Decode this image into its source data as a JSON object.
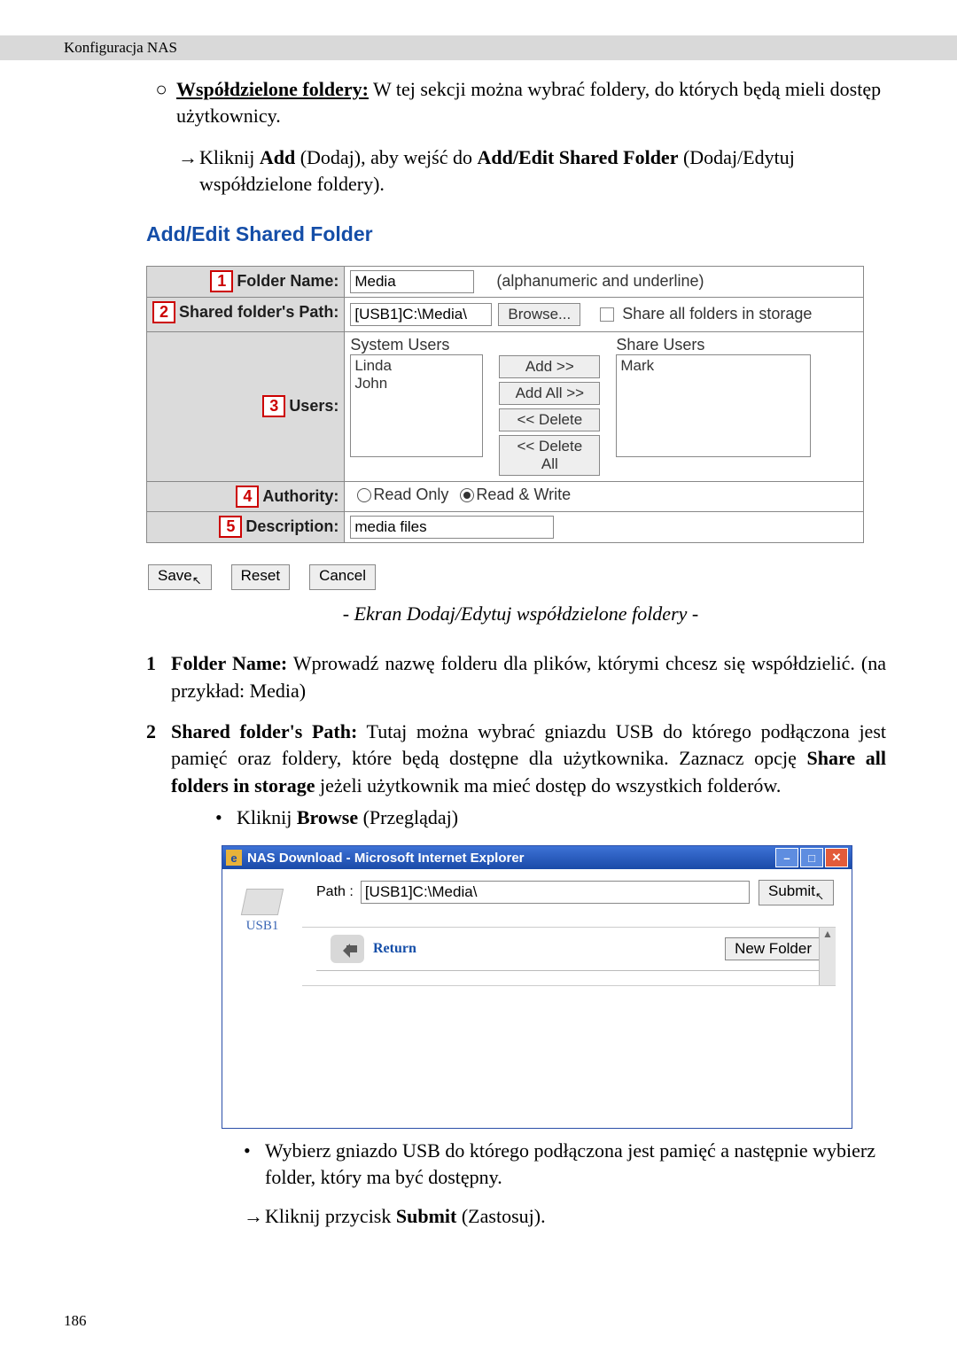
{
  "header": {
    "breadcrumb": "Konfiguracja NAS"
  },
  "intro": {
    "bullet1_prefix": "Współdzielone foldery:",
    "bullet1_rest": " W tej sekcji można wybrać foldery, do których będą mieli dostęp użytkownicy.",
    "arrow_line_1": "Kliknij ",
    "arrow_b1": "Add",
    "arrow_mid1": " (Dodaj), aby wejść do ",
    "arrow_b2": "Add/Edit Shared Folder",
    "arrow_mid2": " (Dodaj/Edytuj współdzielone foldery)."
  },
  "ui1": {
    "title": "Add/Edit Shared Folder",
    "rows": {
      "r1": {
        "num": "1",
        "label": "Folder Name:",
        "value": "Media",
        "hint": "(alphanumeric and underline)"
      },
      "r2": {
        "num": "2",
        "label": "Shared folder's Path:",
        "value": "[USB1]C:\\Media\\",
        "browse": "Browse...",
        "share_label": "Share all folders in storage"
      },
      "r3": {
        "num": "3",
        "label": "Users:",
        "sys_title": "System Users",
        "sys_list": [
          "Linda",
          "John"
        ],
        "btns": {
          "add": "Add >>",
          "addall": "Add All >>",
          "del": "<< Delete",
          "delall": "<< Delete All"
        },
        "share_title": "Share Users",
        "share_list": [
          "Mark"
        ]
      },
      "r4": {
        "num": "4",
        "label": "Authority:",
        "opt1": "Read Only",
        "opt2": "Read & Write"
      },
      "r5": {
        "num": "5",
        "label": "Description:",
        "value": "media files"
      }
    },
    "buttons": {
      "save": "Save",
      "reset": "Reset",
      "cancel": "Cancel"
    }
  },
  "caption1": "- Ekran Dodaj/Edytuj współdzielone foldery -",
  "ol": {
    "i1_num": "1",
    "i1_b": "Folder Name:",
    "i1_t": " Wprowadź nazwę folderu dla plików, którymi chcesz się współdzielić. (na przykład: Media)",
    "i2_num": "2",
    "i2_b": "Shared folder's Path:",
    "i2_t1": " Tutaj można wybrać gniazdu USB do którego podłączona jest pamięć oraz foldery, które będą dostępne dla użytkownika. Zaznacz opcję ",
    "i2_b2": "Share all folders in storage",
    "i2_t2": " jeżeli użytkownik ma mieć dostęp do wszystkich folderów.",
    "i2_sub_pre": "Kliknij ",
    "i2_sub_b": "Browse",
    "i2_sub_post": " (Przeglądaj)"
  },
  "ie": {
    "title": "NAS Download - Microsoft Internet Explorer",
    "side_label": "USB1",
    "path_label": "Path :",
    "path_value": "[USB1]C:\\Media\\",
    "submit": "Submit",
    "return": "Return",
    "newfolder": "New Folder"
  },
  "after_ie": {
    "b1": "Wybierz gniazdo USB do którego podłączona jest pamięć a następnie wybierz folder, który ma być dostępny.",
    "b2_pre": "Kliknij przycisk ",
    "b2_b": "Submit",
    "b2_post": " (Zastosuj)."
  },
  "page_number": "186"
}
